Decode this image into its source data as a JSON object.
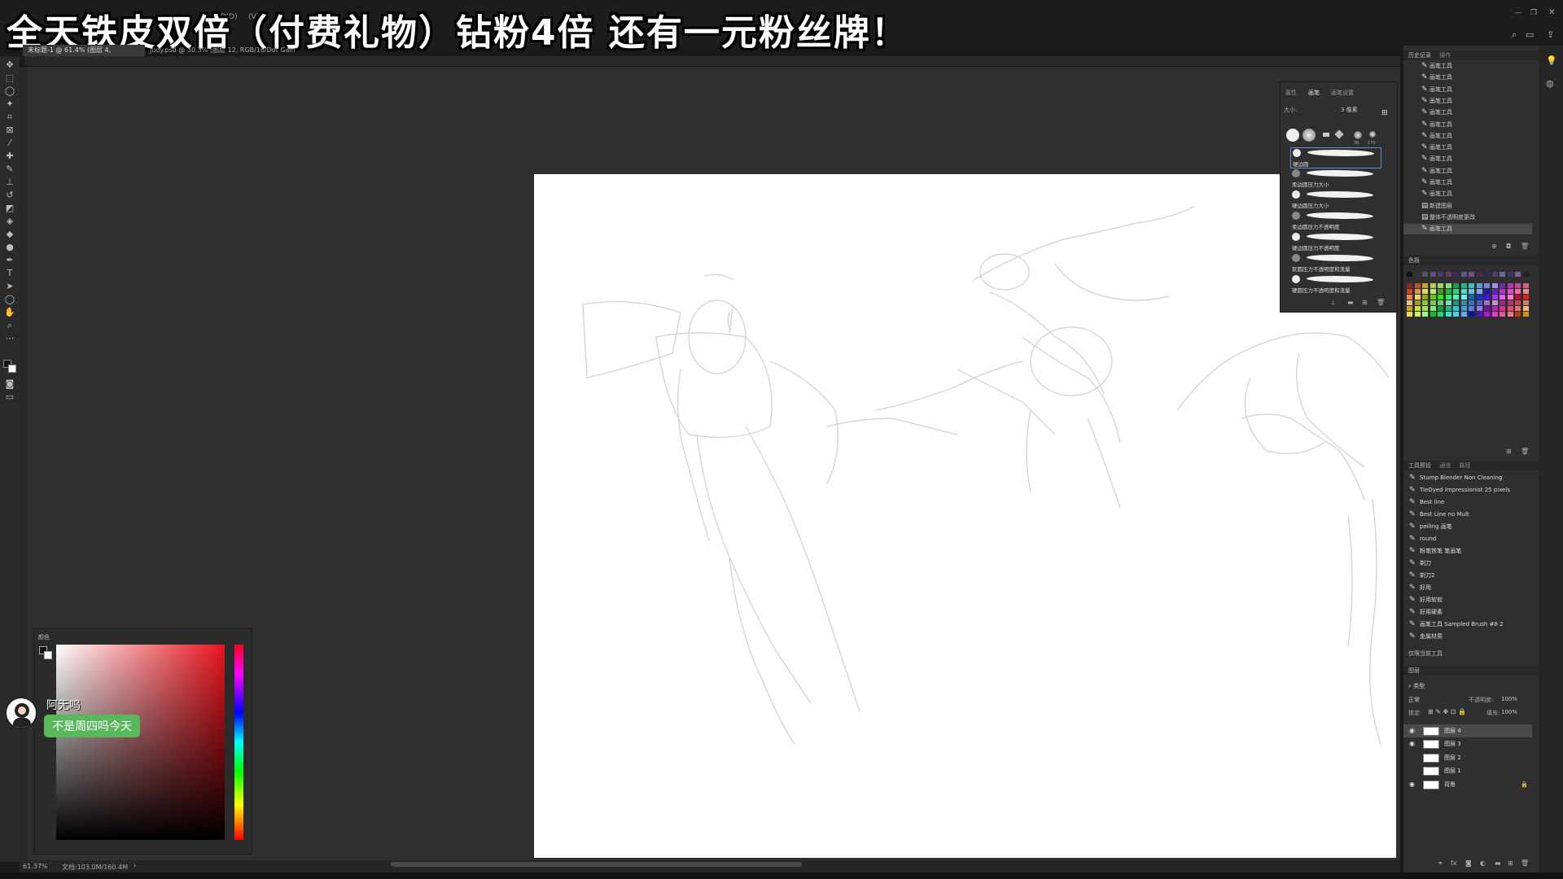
{
  "overlay": {
    "title": "全天铁皮双倍（付费礼物）钻粉4倍 还有一元粉丝牌！"
  },
  "menubar": {
    "items": [
      "3D(D)",
      "(V)"
    ]
  },
  "documents": {
    "tabs": [
      {
        "label": "未标题-1 @ 61.4% (图层 4, RGB/16) *"
      },
      {
        "label": "judy.psd @ 30.3% (图层 12, RGB/16/Dot Gain 20%) *"
      }
    ]
  },
  "statusbar": {
    "zoom": "61.37%",
    "doc_info": "文档:103.0M/160.4M"
  },
  "brush_panel": {
    "tabs": [
      "属性",
      "画笔",
      "画笔设置"
    ],
    "size_label": "大小:",
    "size_value": "3 像素",
    "tip_sizes": [
      "30",
      "175"
    ],
    "brushes": [
      {
        "name": "硬边圆"
      },
      {
        "name": "柔边圆压力大小"
      },
      {
        "name": "硬边圆压力大小"
      },
      {
        "name": "柔边圆压力不透明度"
      },
      {
        "name": "硬边圆压力不透明度"
      },
      {
        "name": "软圆压力不透明度和流量"
      },
      {
        "name": "硬圆压力不透明度和流量"
      }
    ]
  },
  "history_panel": {
    "tabs": [
      "历史记录",
      "操作"
    ],
    "items": [
      {
        "label": "画笔工具"
      },
      {
        "label": "画笔工具"
      },
      {
        "label": "画笔工具"
      },
      {
        "label": "画笔工具"
      },
      {
        "label": "画笔工具"
      },
      {
        "label": "画笔工具"
      },
      {
        "label": "画笔工具"
      },
      {
        "label": "画笔工具"
      },
      {
        "label": "画笔工具"
      },
      {
        "label": "画笔工具"
      },
      {
        "label": "画笔工具"
      },
      {
        "label": "画笔工具"
      },
      {
        "label": "新建图层"
      },
      {
        "label": "整体不透明度更改"
      },
      {
        "label": "画笔工具"
      }
    ]
  },
  "swatches_panel": {
    "title": "色板"
  },
  "tool_presets_panel": {
    "tabs": [
      "工具预设",
      "通道",
      "路径"
    ],
    "items": [
      {
        "label": "Stump Blender Non Cleaning"
      },
      {
        "label": "TieDyed Impressionist 25 pixels"
      },
      {
        "label": "Best line"
      },
      {
        "label": "Best Line no Mult"
      },
      {
        "label": "peiling 画笔"
      },
      {
        "label": "round"
      },
      {
        "label": "粉笔铁笔 笔画笔"
      },
      {
        "label": "剃刀"
      },
      {
        "label": "剃刀2"
      },
      {
        "label": "好用"
      },
      {
        "label": "好用软软"
      },
      {
        "label": "好用硬素"
      },
      {
        "label": "画笔工具 Sampled Brush #8 2"
      },
      {
        "label": "金属材质"
      }
    ],
    "current_only": "仅限当前工具"
  },
  "layers_panel": {
    "title": "图层",
    "filter": "类型",
    "blend_mode": "正常",
    "opacity_label": "不透明度:",
    "opacity_value": "100%",
    "lock_label": "锁定:",
    "fill_label": "填充:",
    "fill_value": "100%",
    "layers": [
      {
        "name": "图层 4",
        "visible": true,
        "selected": true
      },
      {
        "name": "图层 3",
        "visible": true,
        "selected": false
      },
      {
        "name": "图层 2",
        "visible": false,
        "selected": false
      },
      {
        "name": "图层 1",
        "visible": false,
        "selected": false
      },
      {
        "name": "背景",
        "visible": true,
        "selected": false,
        "locked": true
      }
    ]
  },
  "color_panel": {
    "title": "颜色",
    "hue_color": "#e8141e"
  },
  "chat": {
    "username": "阿无呜",
    "message": "不是周四吗今天"
  }
}
